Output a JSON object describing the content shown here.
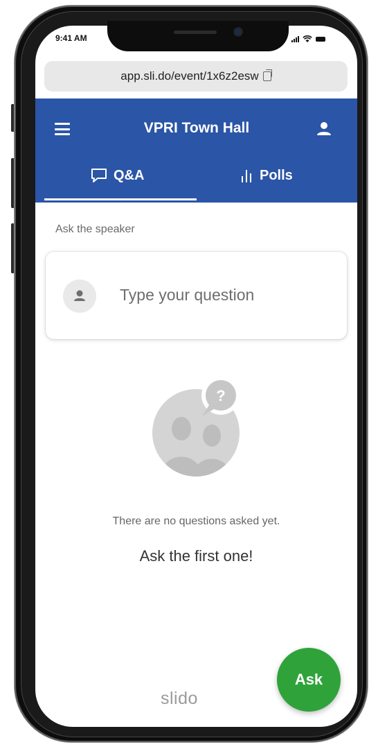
{
  "status": {
    "time": "9:41 AM"
  },
  "browser": {
    "url": "app.sli.do/event/1x6z2esw"
  },
  "header": {
    "title": "VPRI Town Hall"
  },
  "tabs": [
    {
      "label": "Q&A",
      "icon": "chat-icon",
      "active": true
    },
    {
      "label": "Polls",
      "icon": "polls-icon",
      "active": false
    }
  ],
  "main": {
    "section_label": "Ask the speaker",
    "question_placeholder": "Type your question",
    "empty_message": "There are no questions asked yet.",
    "empty_cta": "Ask the first one!"
  },
  "footer": {
    "brand": "slido",
    "ask_button": "Ask"
  },
  "colors": {
    "header_blue": "#2b55a6",
    "ask_green": "#2fa33a",
    "illustration_gray": "#d3d3d3"
  }
}
